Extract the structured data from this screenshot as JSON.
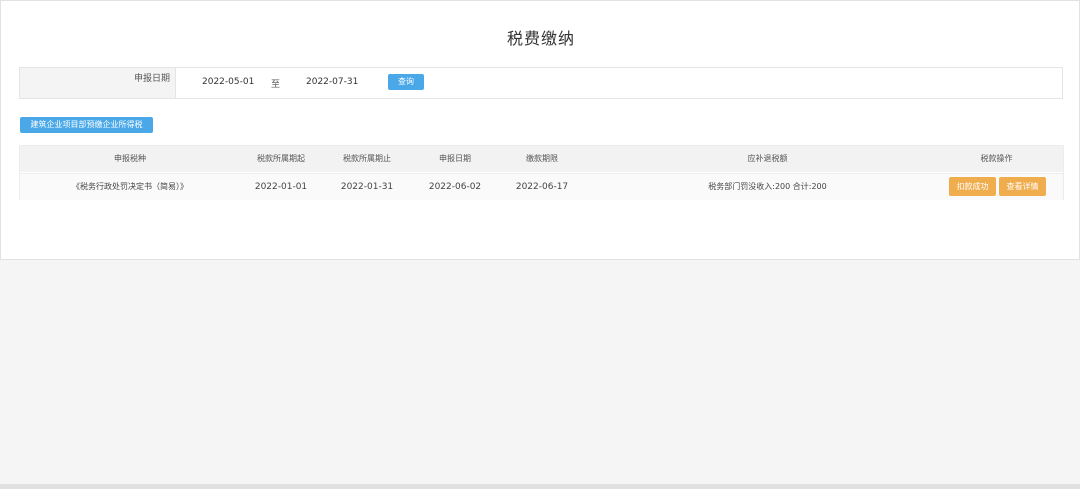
{
  "page": {
    "title": "税费缴纳"
  },
  "filter": {
    "label": "申报日期",
    "start_date": "2022-05-01",
    "separator": "至",
    "end_date": "2022-07-31",
    "query_label": "查询"
  },
  "action_button_label": "建筑企业项目部预缴企业所得税",
  "table": {
    "headers": [
      "申报税种",
      "税款所属期起",
      "税款所属期止",
      "申报日期",
      "缴款期限",
      "应补退税额",
      "税款操作"
    ],
    "rows": [
      {
        "tax_type": "《税务行政处罚决定书（简易）》",
        "period_start": "2022-01-01",
        "period_end": "2022-01-31",
        "declare_date": "2022-06-02",
        "deadline": "2022-06-17",
        "amount": "税务部门罚没收入:200 合计:200",
        "actions": [
          "扣款成功",
          "查看详情"
        ]
      }
    ]
  },
  "colors": {
    "accent_blue": "#4aa8e8",
    "action_orange": "#f0ad4e",
    "background": "#f5f5f5"
  }
}
